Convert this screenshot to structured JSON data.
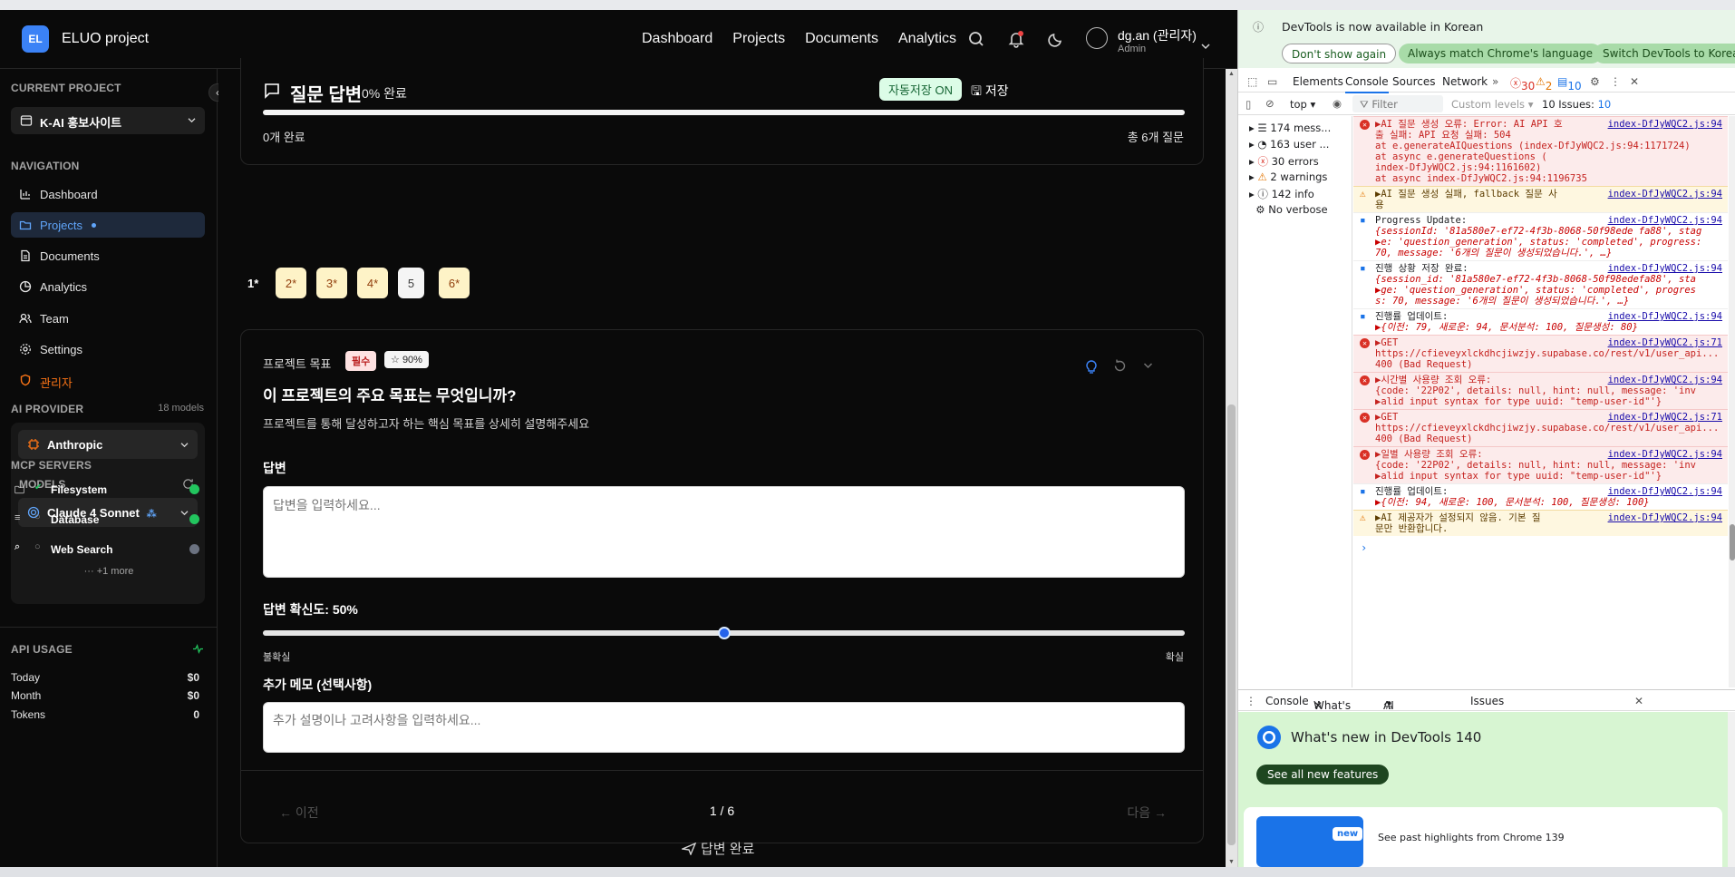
{
  "app": {
    "logo_initials": "EL",
    "title": "ELUO project",
    "nav": [
      "Dashboard",
      "Projects",
      "Documents",
      "Analytics"
    ],
    "user_name": "dg.an (관리자)",
    "user_role": "Admin"
  },
  "sidebar": {
    "current_project_label": "CURRENT PROJECT",
    "current_project": "K-AI 홍보사이트",
    "navigation_label": "NAVIGATION",
    "items": [
      {
        "label": "Dashboard",
        "icon": "dashboard-icon"
      },
      {
        "label": "Projects",
        "icon": "folder-icon"
      },
      {
        "label": "Documents",
        "icon": "document-icon"
      },
      {
        "label": "Analytics",
        "icon": "analytics-icon"
      },
      {
        "label": "Team",
        "icon": "team-icon"
      },
      {
        "label": "Settings",
        "icon": "settings-icon"
      },
      {
        "label": "관리자",
        "icon": "shield-icon"
      }
    ],
    "ai_provider_label": "AI PROVIDER",
    "ai_provider_count": "18 models",
    "provider": "Anthropic",
    "models_label": "MODELS",
    "model": "Claude 4 Sonnet",
    "mcp_label": "MCP SERVERS",
    "mcp_servers": [
      {
        "name": "Filesystem",
        "status_color": "#22c55e"
      },
      {
        "name": "Database",
        "status_color": "#22c55e"
      },
      {
        "name": "Web Search",
        "status_color": "#6b7280"
      }
    ],
    "mcp_more": "+1 more",
    "api_usage_label": "API USAGE",
    "usage": [
      {
        "label": "Today",
        "value": "$0"
      },
      {
        "label": "Month",
        "value": "$0"
      },
      {
        "label": "Tokens",
        "value": "0"
      }
    ]
  },
  "main": {
    "header_title": "질문 답변",
    "header_progress": "0% 완료",
    "autosave": "자동저장 ON",
    "save": "저장",
    "progress_fraction": 0.0,
    "completed_text": "0개 완료",
    "total_text": "총 6개 질문",
    "question_numbers": [
      "1*",
      "2*",
      "3*",
      "4*",
      "5",
      "6*"
    ],
    "question": {
      "category": "프로젝트 목표",
      "required_badge": "필수",
      "score_badge": "90%",
      "title": "이 프로젝트의 주요 목표는 무엇입니까?",
      "description": "프로젝트를 통해 달성하고자 하는 핵심 목표를 상세히 설명해주세요",
      "answer_label": "답변",
      "answer_placeholder": "답변을 입력하세요...",
      "confidence_label": "답변 확신도: 50%",
      "confidence_value": 0.5,
      "confidence_min": "불확실",
      "confidence_max": "확실",
      "memo_label": "추가 메모 (선택사항)",
      "memo_placeholder": "추가 설명이나 고려사항을 입력하세요..."
    },
    "prev": "이전",
    "page_indicator": "1 / 6",
    "next": "다음",
    "submit": "답변 완료"
  },
  "devtools": {
    "banner_text": "DevTools is now available in Korean",
    "btn_dont_show": "Don't show again",
    "btn_match": "Always match Chrome's language",
    "btn_switch": "Switch DevTools to Korean",
    "tabs": [
      "Elements",
      "Console",
      "Sources",
      "Network"
    ],
    "error_count": "30",
    "warn_count": "2",
    "issue_count": "10",
    "context": "top",
    "filter_placeholder": "Filter",
    "levels": "Custom levels",
    "issues_text": "10 Issues:",
    "issues_badge": "10",
    "side": [
      "174 mess...",
      "163 user ...",
      "30 errors",
      "2 warnings",
      "142 info",
      "No verbose"
    ],
    "log": [
      {
        "type": "err",
        "lines": [
          "▶AI 질문 생성 오류: Error: AI API 호",
          "출 실패: API 요청 실패: 504",
          "    at e.generateAIQuestions (index-DfJyWQC2.js:94:1171724)",
          "    at async e.generateQuestions (",
          "index-DfJyWQC2.js:94:1161602)",
          "    at async index-DfJyWQC2.js:94:1196735"
        ],
        "src": "index-DfJyWQC2.js:94"
      },
      {
        "type": "warn",
        "lines": [
          "▶AI 질문 생성 실패, fallback 질문 사",
          "용"
        ],
        "src": "index-DfJyWQC2.js:94"
      },
      {
        "type": "info",
        "lines": [
          "Progress Update:",
          "{sessionId: '81a580e7-ef72-4f3b-8068-50f98ede fa88', stag",
          "▶e: 'question_generation', status: 'completed', progress:",
          "70, message: '6개의 질문이 생성되었습니다.', …}"
        ],
        "src": "index-DfJyWQC2.js:94"
      },
      {
        "type": "info",
        "lines": [
          "진행 상황 저장 완료:",
          "{session_id: '81a580e7-ef72-4f3b-8068-50f98edefa88', sta",
          "▶ge: 'question_generation', status: 'completed', progres",
          "s: 70, message: '6개의 질문이 생성되었습니다.', …}"
        ],
        "src": "index-DfJyWQC2.js:94"
      },
      {
        "type": "info",
        "lines": [
          "진행률 업데이트:",
          "▶{이전: 79, 새로운: 94, 문서분석: 100, 질문생성: 80}"
        ],
        "src": "index-DfJyWQC2.js:94"
      },
      {
        "type": "err",
        "lines": [
          "▶GET",
          "https://cfieveyxlckdhcjiwzjy.supabase.co/rest/v1/user_api...",
          "400 (Bad Request)"
        ],
        "src": "index-DfJyWQC2.js:71"
      },
      {
        "type": "err",
        "lines": [
          "▶시간별 사용량 조회 오류:",
          "{code: '22P02', details: null, hint: null, message: 'inv",
          "▶alid input syntax for type uuid: \"temp-user-id\"'}"
        ],
        "src": "index-DfJyWQC2.js:94"
      },
      {
        "type": "err",
        "lines": [
          "▶GET",
          "https://cfieveyxlckdhcjiwzjy.supabase.co/rest/v1/user_api...",
          "400 (Bad Request)"
        ],
        "src": "index-DfJyWQC2.js:71"
      },
      {
        "type": "err",
        "lines": [
          "▶일별 사용량 조회 오류:",
          "{code: '22P02', details: null, hint: null, message: 'inv",
          "▶alid input syntax for type uuid: \"temp-user-id\"'}"
        ],
        "src": "index-DfJyWQC2.js:94"
      },
      {
        "type": "info",
        "lines": [
          "진행률 업데이트:",
          "▶{이전: 94, 새로운: 100, 문서분석: 100, 질문생성: 100}"
        ],
        "src": "index-DfJyWQC2.js:94"
      },
      {
        "type": "warn",
        "lines": [
          "▶AI 제공자가 설정되지 않음. 기본 질",
          "문만 반환합니다."
        ],
        "src": "index-DfJyWQC2.js:94"
      }
    ],
    "drawer_tabs": [
      "Console",
      "What's new",
      "AI assistance",
      "Issues"
    ],
    "whats_new_title": "What's new in DevTools 140",
    "see_all": "See all new features",
    "new_badge": "new",
    "highlights": "See past highlights from Chrome 139"
  }
}
